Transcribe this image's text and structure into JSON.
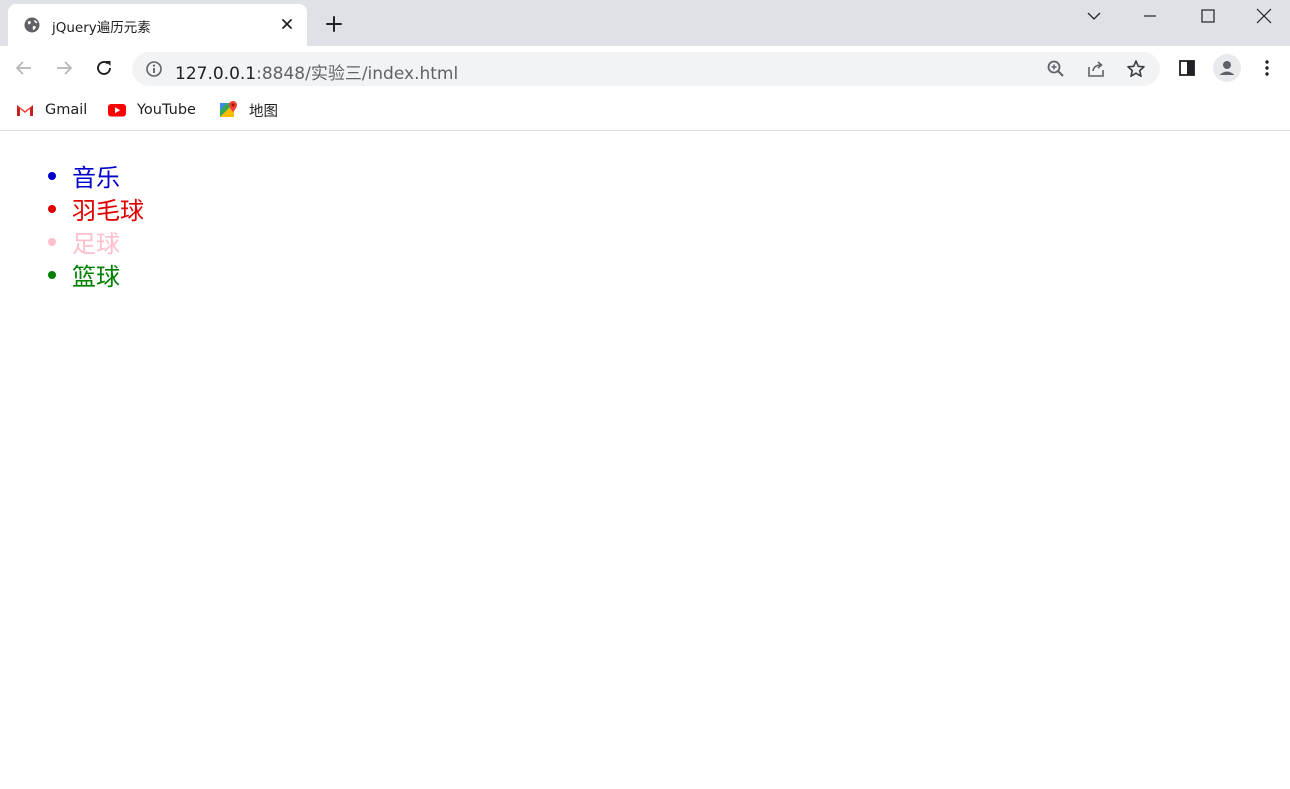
{
  "tab": {
    "title": "jQuery遍历元素",
    "favicon": "globe-icon"
  },
  "toolbar": {
    "url_host": "127.0.0.1",
    "url_path": ":8848/实验三/index.html"
  },
  "bookmarks": [
    {
      "label": "Gmail",
      "icon": "gmail-icon"
    },
    {
      "label": "YouTube",
      "icon": "youtube-icon"
    },
    {
      "label": "地图",
      "icon": "maps-icon"
    }
  ],
  "page": {
    "items": [
      {
        "label": "音乐",
        "color": "#0000cc"
      },
      {
        "label": "羽毛球",
        "color": "#e00000"
      },
      {
        "label": "足球",
        "color": "#ffc0cb"
      },
      {
        "label": "篮球",
        "color": "#008000"
      }
    ]
  }
}
